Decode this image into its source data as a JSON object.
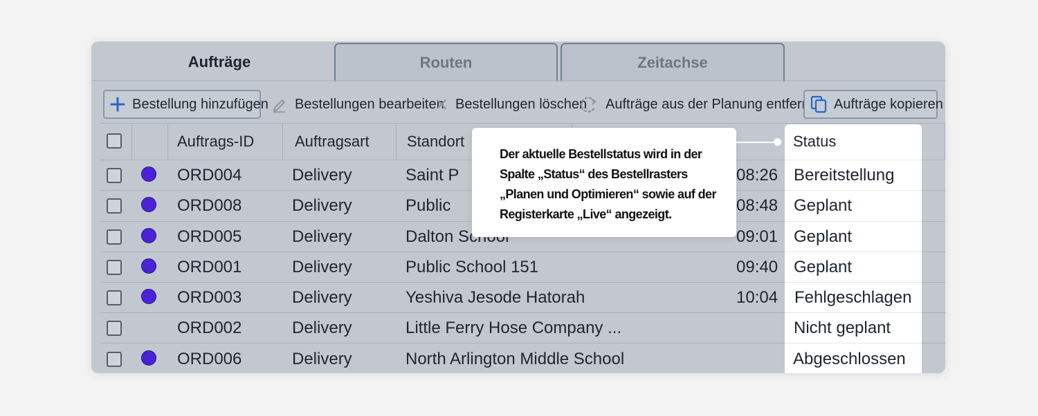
{
  "tabs": [
    {
      "label": "Aufträge",
      "active": true
    },
    {
      "label": "Routen",
      "active": false
    },
    {
      "label": "Zeitachse",
      "active": false
    }
  ],
  "toolbar": {
    "add_label": "Bestellung hinzufügen",
    "edit_label": "Bestellungen bearbeiten",
    "delete_label": "Bestellungen löschen",
    "unschedule_label": "Aufträge aus der Planung entfernen",
    "copy_label": "Aufträge kopieren"
  },
  "grid": {
    "headers": {
      "order_id": "Auftrags-ID",
      "order_type": "Auftragsart",
      "location": "Standort",
      "status": "Status"
    },
    "rows": [
      {
        "id": "ORD004",
        "type": "Delivery",
        "location": "Saint P",
        "time": "08:26",
        "status": "Bereitstellung",
        "dot": true
      },
      {
        "id": "ORD008",
        "type": "Delivery",
        "location": "Public",
        "time": "08:48",
        "status": "Geplant",
        "dot": true
      },
      {
        "id": "ORD005",
        "type": "Delivery",
        "location": "Dalton School",
        "time": "09:01",
        "status": "Geplant",
        "dot": true
      },
      {
        "id": "ORD001",
        "type": "Delivery",
        "location": "Public School 151",
        "time": "09:40",
        "status": "Geplant",
        "dot": true
      },
      {
        "id": "ORD003",
        "type": "Delivery",
        "location": "Yeshiva Jesode Hatorah",
        "time": "10:04",
        "status": "Fehlgeschlagen",
        "dot": true
      },
      {
        "id": "ORD002",
        "type": "Delivery",
        "location": "Little Ferry Hose Company ...",
        "time": "",
        "status": "Nicht geplant",
        "dot": false
      },
      {
        "id": "ORD006",
        "type": "Delivery",
        "location": "North Arlington Middle School",
        "time": "",
        "status": "Abgeschlossen",
        "dot": true
      }
    ]
  },
  "callout": {
    "lines": [
      "Der aktuelle Bestellstatus wird in der",
      "Spalte „Status“ des Bestellrasters",
      "„Planen und Optimieren“ sowie auf der",
      "Registerkarte „Live“ angezeigt."
    ]
  },
  "colors": {
    "route_dot": "#4b22d8",
    "accent_icon": "#2764c8",
    "grid_background": "#c3c8d0"
  }
}
